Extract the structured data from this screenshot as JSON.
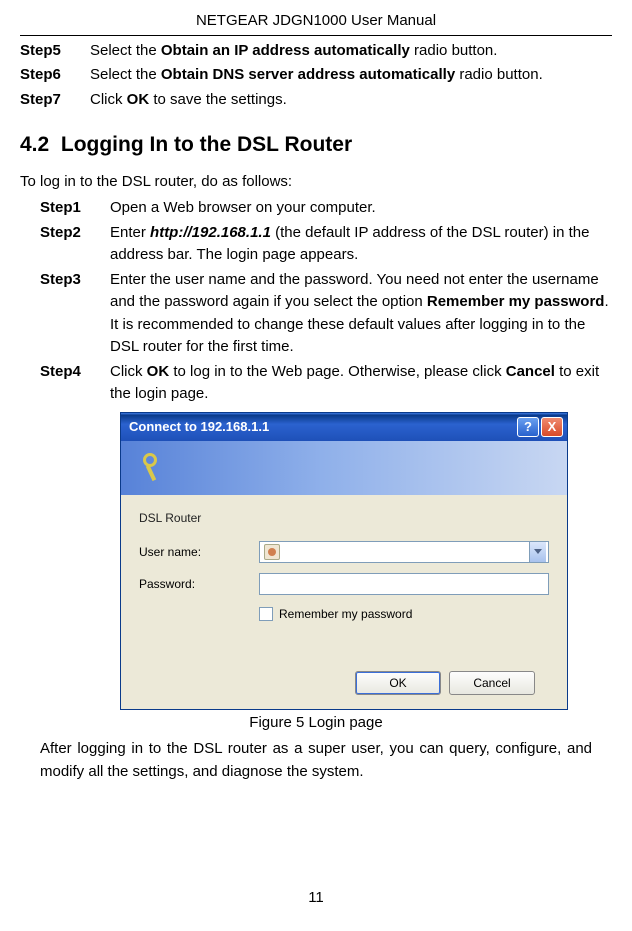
{
  "header": {
    "title": "NETGEAR JDGN1000 User Manual"
  },
  "topSteps": [
    {
      "label": "Step5",
      "pre": "Select the ",
      "bold": "Obtain an IP address automatically",
      "post": " radio button."
    },
    {
      "label": "Step6",
      "pre": "Select the ",
      "bold": "Obtain DNS server address automatically",
      "post": " radio button."
    },
    {
      "label": "Step7",
      "pre": "Click ",
      "bold": "OK",
      "post": " to save the settings."
    }
  ],
  "section": {
    "number": "4.2",
    "title": "Logging In to the DSL Router"
  },
  "intro": "To log in to the DSL router, do as follows:",
  "steps": {
    "s1": {
      "label": "Step1",
      "text": "Open a Web browser on your computer."
    },
    "s2": {
      "label": "Step2",
      "pre": "Enter ",
      "url": "http://192.168.1.1",
      "post1": " (the default IP address of the DSL router) in the address bar. The login page appears."
    },
    "s3": {
      "label": "Step3",
      "pre": "Enter the user name and the password. You need not enter the username and the password again if you select the option ",
      "bold": "Remember my password",
      "post": ". It is recommended to change these default values after logging in to the DSL router for the first time."
    },
    "s4": {
      "label": "Step4",
      "t1": "Click ",
      "b1": "OK",
      "t2": " to log in to the Web page. Otherwise, please click ",
      "b2": "Cancel",
      "t3": " to exit the login page."
    }
  },
  "dialog": {
    "title": "Connect to 192.168.1.1",
    "help": "?",
    "close": "X",
    "subtitle": "DSL Router",
    "username_label": "User name:",
    "password_label": "Password:",
    "remember": "Remember my password",
    "ok": "OK",
    "cancel": "Cancel"
  },
  "figure": "Figure 5 Login page",
  "afterText": "After logging in to the DSL router as a super user, you can query, configure, and modify all the settings, and diagnose the system.",
  "pageNum": "11"
}
